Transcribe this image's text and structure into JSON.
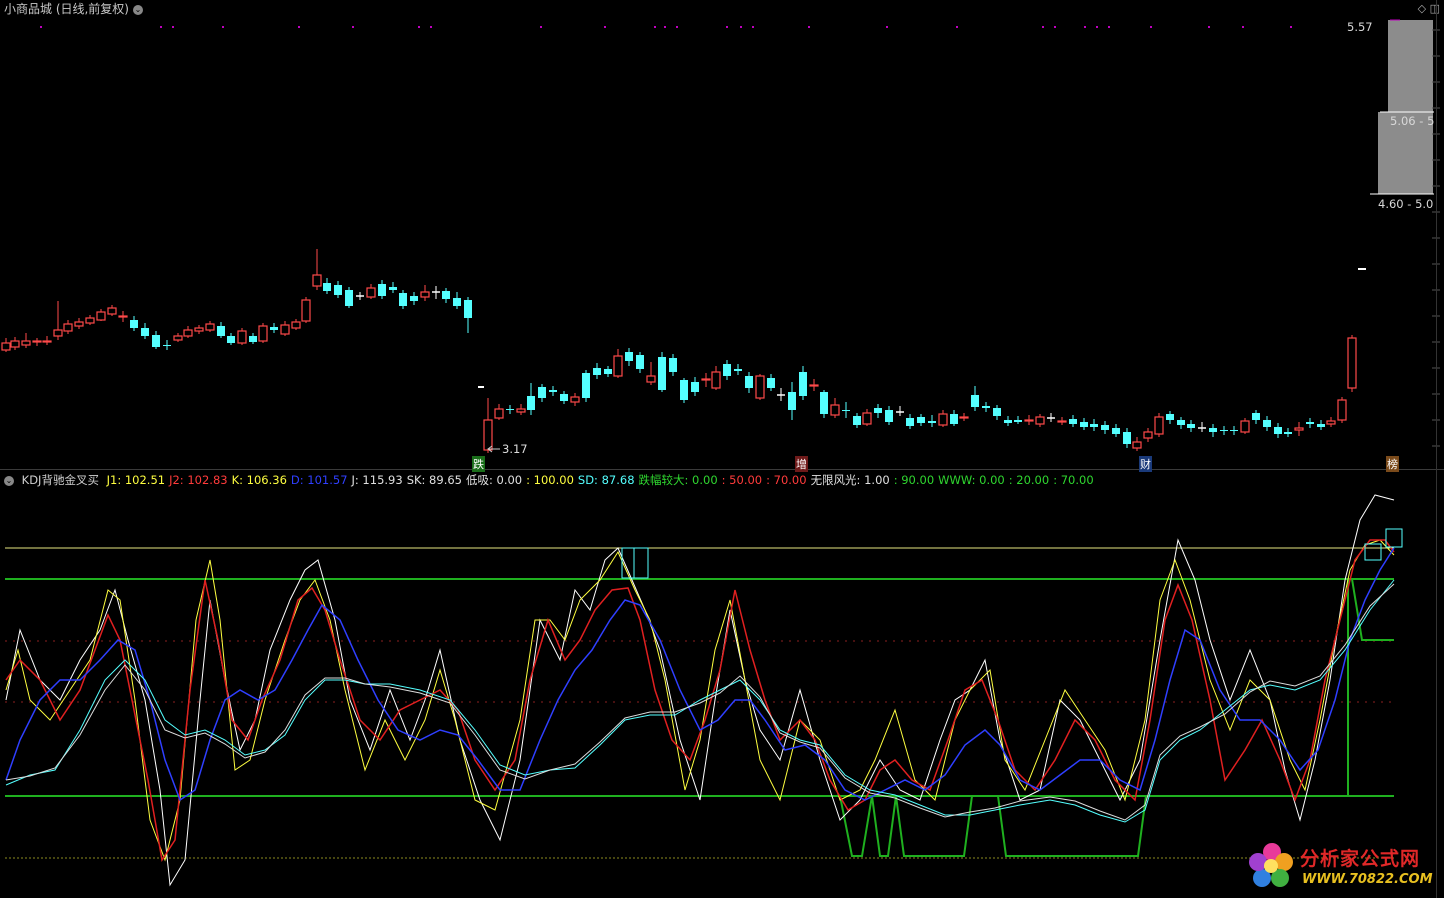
{
  "window": {
    "title": "小商品城 (日线,前复权)",
    "icons": [
      "diamond-icon",
      "window-icon"
    ]
  },
  "price_panel": {
    "low_marker": "3.17",
    "range_labels": [
      "5.57",
      "5.06 - 5",
      "4.60 - 5.0"
    ],
    "event_tags": [
      "跌",
      "增",
      "财",
      "榜"
    ],
    "colors": {
      "up": "#ff4a4a",
      "down": "#54ffff",
      "flat": "#ffffff",
      "magenta_dots": "#c000c0"
    }
  },
  "kdj_panel": {
    "name": "KDJ背驰金叉买",
    "items": [
      {
        "text": "J1: 102.51",
        "color": "#ffff40"
      },
      {
        "text": "J2: 102.83",
        "color": "#ff3b3b"
      },
      {
        "text": "K: 106.36",
        "color": "#ffff40"
      },
      {
        "text": "D: 101.57",
        "color": "#2f3fff"
      },
      {
        "text": "J: 115.93",
        "color": "#e0e0e0"
      },
      {
        "text": "SK: 89.65",
        "color": "#e0e0e0"
      },
      {
        "text": "低吸: 0.00",
        "color": "#e0e0e0"
      },
      {
        "text": ": 100.00",
        "color": "#ffff40"
      },
      {
        "text": "SD: 87.68",
        "color": "#54ffff"
      },
      {
        "text": "跌幅较大: 0.00",
        "color": "#2fd62f"
      },
      {
        "text": ": 50.00",
        "color": "#ff3b3b"
      },
      {
        "text": ": 70.00",
        "color": "#ff3b3b"
      },
      {
        "text": "无限风光: 1.00",
        "color": "#e0e0e0"
      },
      {
        "text": ": 90.00",
        "color": "#2fd62f"
      },
      {
        "text": "WWW: 0.00",
        "color": "#2fd62f"
      },
      {
        "text": ": 20.00",
        "color": "#2fd62f"
      },
      {
        "text": ": 70.00",
        "color": "#2fd62f"
      }
    ]
  },
  "watermark": {
    "name": "分析家公式网",
    "url": "WWW.70822.COM"
  }
}
